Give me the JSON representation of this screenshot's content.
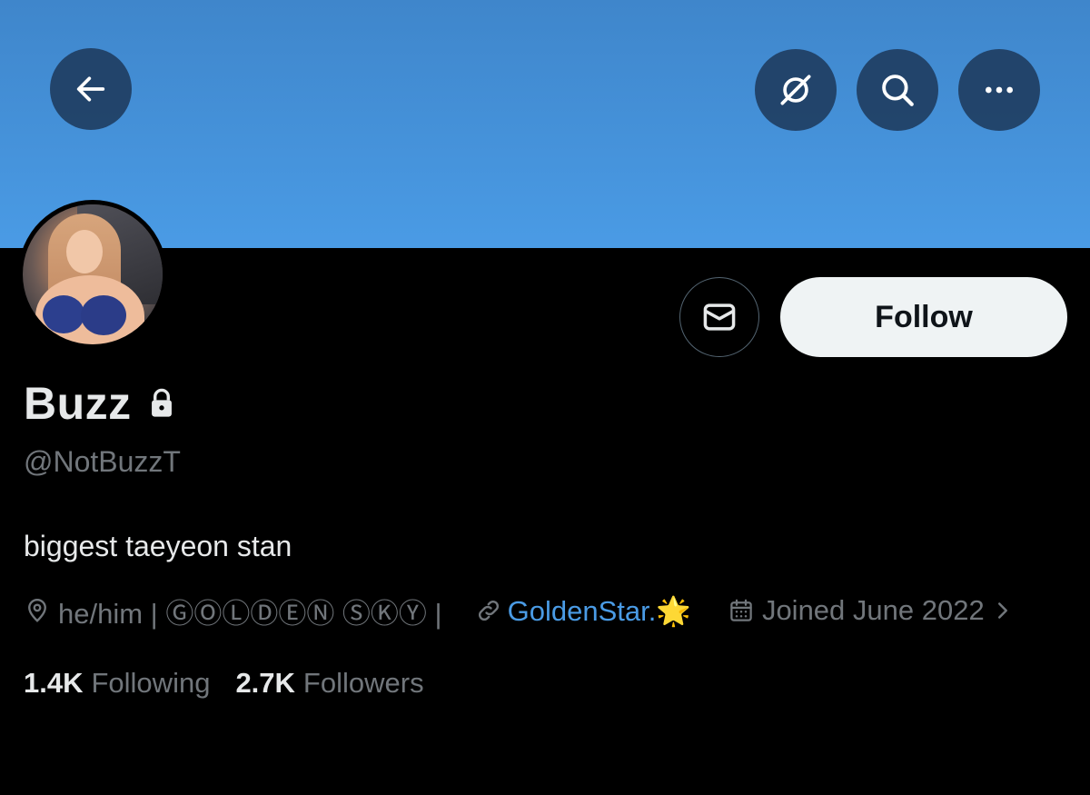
{
  "header": {
    "back_icon": "arrow-left-icon",
    "grok_icon": "grok-icon",
    "search_icon": "search-icon",
    "more_icon": "more-horizontal-icon",
    "banner_color": "#4a9be5"
  },
  "profile": {
    "avatar_alt": "avatar",
    "display_name": "Buzz",
    "protected_icon": "lock-icon",
    "handle": "@NotBuzzT",
    "bio": "biggest taeyeon stan",
    "location": "he/him | ⒼⓄⓁⒹⒺⓃ ⓈⓀⓎ |",
    "website": "GoldenStar.🌟",
    "joined": "Joined June 2022"
  },
  "actions": {
    "message_icon": "mail-icon",
    "follow_label": "Follow"
  },
  "stats": {
    "following_count": "1.4K",
    "following_label": "Following",
    "followers_count": "2.7K",
    "followers_label": "Followers"
  },
  "colors": {
    "link": "#4a9be5",
    "muted": "#71767b",
    "text": "#e7e9ea",
    "background": "#000000"
  }
}
